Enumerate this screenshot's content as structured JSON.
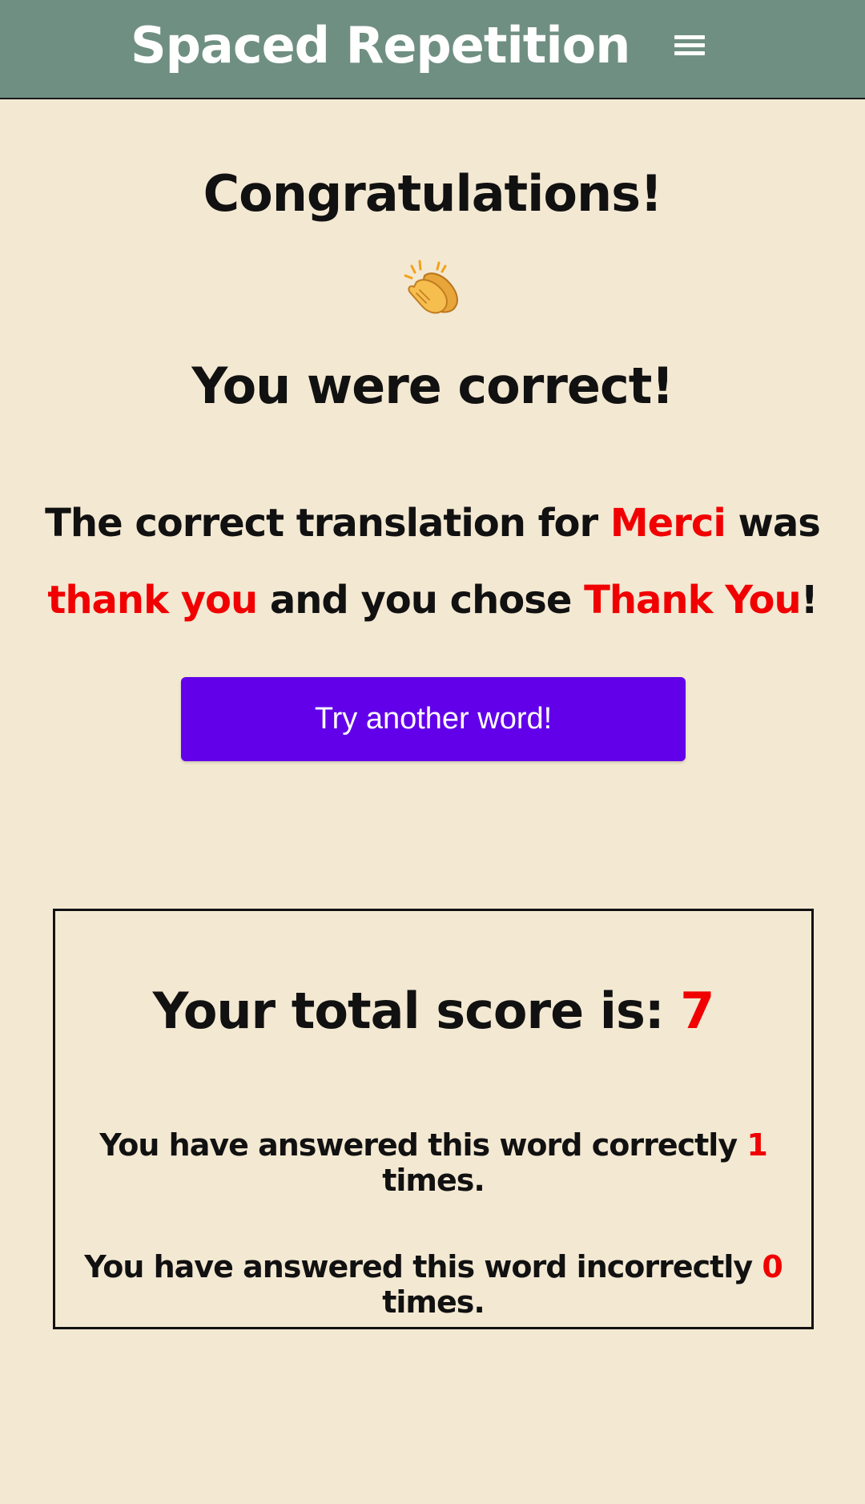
{
  "header": {
    "title": "Spaced Repetition",
    "menu_icon": "hamburger-menu-icon",
    "background": "#6f8f82"
  },
  "feedback": {
    "title": "Congratulations!",
    "icon": "clapping-hands-icon",
    "result": "You were correct!",
    "translation": {
      "prefix": "The correct translation for ",
      "original_word": "Merci",
      "middle": " was ",
      "correct_answer": "thank you",
      "connector": " and you chose ",
      "user_answer": "Thank You",
      "suffix": "!"
    },
    "highlight_color": "#f00000"
  },
  "actions": {
    "next_button_label": "Try another word!",
    "next_button_color": "#6200ea"
  },
  "score": {
    "label": "Your total score is: ",
    "total": "7",
    "correct_prefix": "You have answered this word correctly ",
    "correct_count": "1",
    "correct_suffix": " times.",
    "incorrect_prefix": "You have answered this word incorrectly ",
    "incorrect_count": "0",
    "incorrect_suffix": " times."
  },
  "page_background": "#f3e8d2"
}
